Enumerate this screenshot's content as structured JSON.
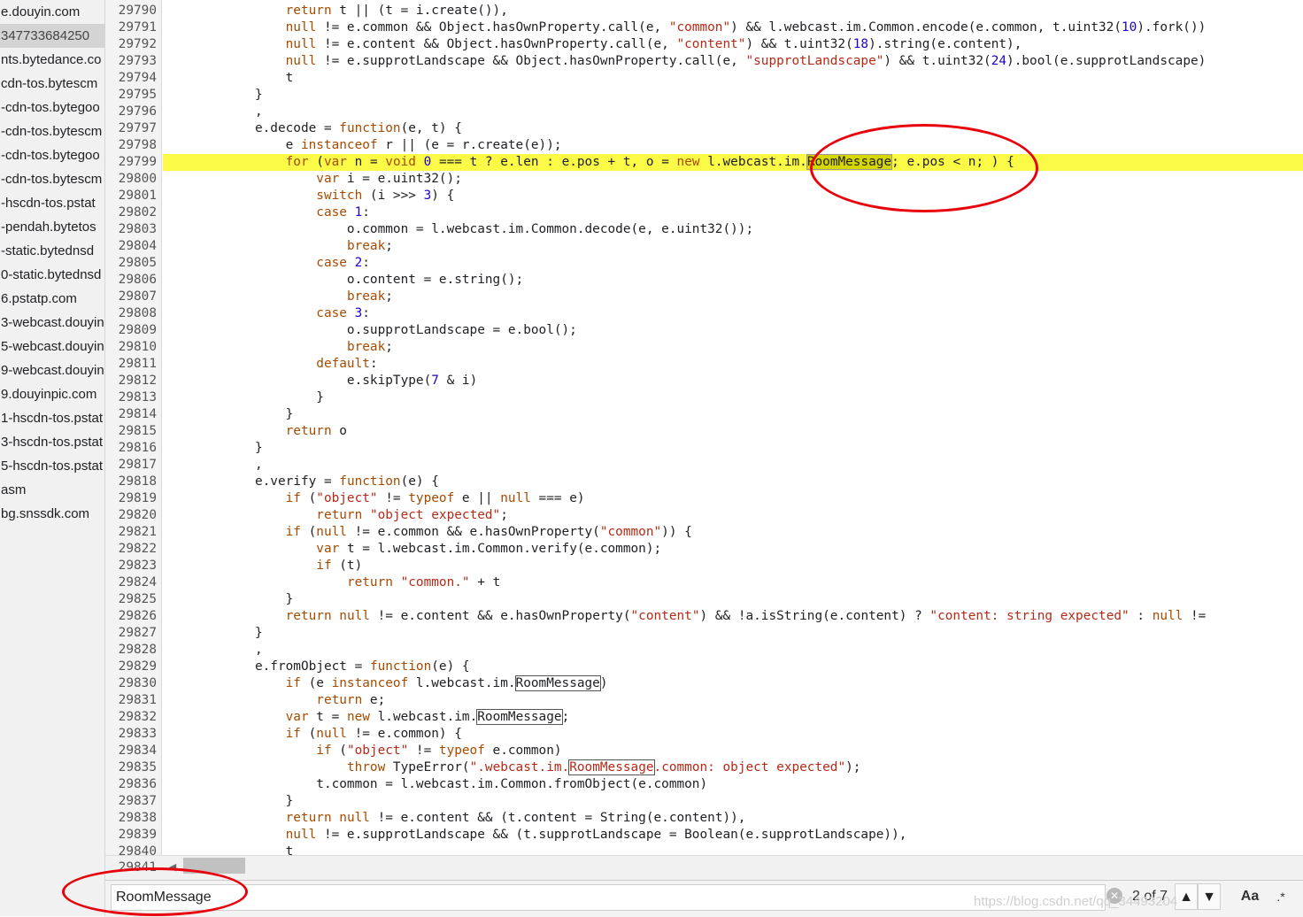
{
  "sidebar": {
    "items": [
      {
        "label": "e.douyin.com"
      },
      {
        "label": "347733684250"
      },
      {
        "label": "nts.bytedance.co"
      },
      {
        "label": "cdn-tos.bytescm"
      },
      {
        "label": "-cdn-tos.bytegoo"
      },
      {
        "label": "-cdn-tos.bytescm"
      },
      {
        "label": "-cdn-tos.bytegoo"
      },
      {
        "label": "-cdn-tos.bytescm"
      },
      {
        "label": "-hscdn-tos.pstat"
      },
      {
        "label": "-pendah.bytetos"
      },
      {
        "label": "-static.bytednsd"
      },
      {
        "label": "0-static.bytednsd"
      },
      {
        "label": "6.pstatp.com"
      },
      {
        "label": "3-webcast.douyin"
      },
      {
        "label": "5-webcast.douyin"
      },
      {
        "label": "9-webcast.douyin"
      },
      {
        "label": "9.douyinpic.com"
      },
      {
        "label": "1-hscdn-tos.pstat"
      },
      {
        "label": "3-hscdn-tos.pstat"
      },
      {
        "label": "5-hscdn-tos.pstat"
      },
      {
        "label": "asm"
      },
      {
        "label": "bg.snssdk.com"
      }
    ]
  },
  "editor": {
    "highlighted_line": "29799",
    "lines": [
      {
        "n": "29790",
        "code": "                return t || (t = i.create()),"
      },
      {
        "n": "29791",
        "code": "                null != e.common && Object.hasOwnProperty.call(e, \"common\") && l.webcast.im.Common.encode(e.common, t.uint32(10).fork())"
      },
      {
        "n": "29792",
        "code": "                null != e.content && Object.hasOwnProperty.call(e, \"content\") && t.uint32(18).string(e.content),"
      },
      {
        "n": "29793",
        "code": "                null != e.supprotLandscape && Object.hasOwnProperty.call(e, \"supprotLandscape\") && t.uint32(24).bool(e.supprotLandscape)"
      },
      {
        "n": "29794",
        "code": "                t"
      },
      {
        "n": "29795",
        "code": "            }"
      },
      {
        "n": "29796",
        "code": "            ,"
      },
      {
        "n": "29797",
        "code": "            e.decode = function(e, t) {"
      },
      {
        "n": "29798",
        "code": "                e instanceof r || (e = r.create(e));"
      },
      {
        "n": "29799",
        "code": "                for (var n = void 0 === t ? e.len : e.pos + t, o = new l.webcast.im.RoomMessage; e.pos < n; ) {"
      },
      {
        "n": "29800",
        "code": "                    var i = e.uint32();"
      },
      {
        "n": "29801",
        "code": "                    switch (i >>> 3) {"
      },
      {
        "n": "29802",
        "code": "                    case 1:"
      },
      {
        "n": "29803",
        "code": "                        o.common = l.webcast.im.Common.decode(e, e.uint32());"
      },
      {
        "n": "29804",
        "code": "                        break;"
      },
      {
        "n": "29805",
        "code": "                    case 2:"
      },
      {
        "n": "29806",
        "code": "                        o.content = e.string();"
      },
      {
        "n": "29807",
        "code": "                        break;"
      },
      {
        "n": "29808",
        "code": "                    case 3:"
      },
      {
        "n": "29809",
        "code": "                        o.supprotLandscape = e.bool();"
      },
      {
        "n": "29810",
        "code": "                        break;"
      },
      {
        "n": "29811",
        "code": "                    default:"
      },
      {
        "n": "29812",
        "code": "                        e.skipType(7 & i)"
      },
      {
        "n": "29813",
        "code": "                    }"
      },
      {
        "n": "29814",
        "code": "                }"
      },
      {
        "n": "29815",
        "code": "                return o"
      },
      {
        "n": "29816",
        "code": "            }"
      },
      {
        "n": "29817",
        "code": "            ,"
      },
      {
        "n": "29818",
        "code": "            e.verify = function(e) {"
      },
      {
        "n": "29819",
        "code": "                if (\"object\" != typeof e || null === e)"
      },
      {
        "n": "29820",
        "code": "                    return \"object expected\";"
      },
      {
        "n": "29821",
        "code": "                if (null != e.common && e.hasOwnProperty(\"common\")) {"
      },
      {
        "n": "29822",
        "code": "                    var t = l.webcast.im.Common.verify(e.common);"
      },
      {
        "n": "29823",
        "code": "                    if (t)"
      },
      {
        "n": "29824",
        "code": "                        return \"common.\" + t"
      },
      {
        "n": "29825",
        "code": "                }"
      },
      {
        "n": "29826",
        "code": "                return null != e.content && e.hasOwnProperty(\"content\") && !a.isString(e.content) ? \"content: string expected\" : null !="
      },
      {
        "n": "29827",
        "code": "            }"
      },
      {
        "n": "29828",
        "code": "            ,"
      },
      {
        "n": "29829",
        "code": "            e.fromObject = function(e) {"
      },
      {
        "n": "29830",
        "code": "                if (e instanceof l.webcast.im.RoomMessage)"
      },
      {
        "n": "29831",
        "code": "                    return e;"
      },
      {
        "n": "29832",
        "code": "                var t = new l.webcast.im.RoomMessage;"
      },
      {
        "n": "29833",
        "code": "                if (null != e.common) {"
      },
      {
        "n": "29834",
        "code": "                    if (\"object\" != typeof e.common)"
      },
      {
        "n": "29835",
        "code": "                        throw TypeError(\".webcast.im.RoomMessage.common: object expected\");"
      },
      {
        "n": "29836",
        "code": "                    t.common = l.webcast.im.Common.fromObject(e.common)"
      },
      {
        "n": "29837",
        "code": "                }"
      },
      {
        "n": "29838",
        "code": "                return null != e.content && (t.content = String(e.content)),"
      },
      {
        "n": "29839",
        "code": "                null != e.supprotLandscape && (t.supprotLandscape = Boolean(e.supprotLandscape)),"
      },
      {
        "n": "29840",
        "code": "                t"
      }
    ],
    "footer_line": "29841"
  },
  "search": {
    "query": "RoomMessage",
    "match_count": "2 of 7",
    "clear_icon": "clear-icon",
    "prev_icon": "arrow-up-icon",
    "next_icon": "arrow-down-icon",
    "case_label": "Aa",
    "regex_label": ".*"
  },
  "watermark": "https://blog.csdn.net/qq_34493204",
  "colors": {
    "highlight": "#fbfb47",
    "annotation": "#e8000b",
    "keyword": "#a64b00",
    "string": "#b42a17",
    "number": "#1c00cf"
  }
}
